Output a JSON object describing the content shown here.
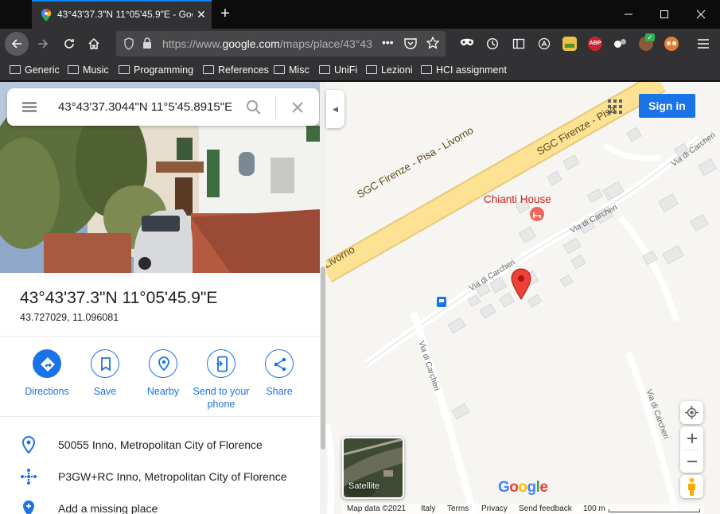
{
  "browser": {
    "tab_title": "43°43'37.3\"N 11°05'45.9\"E - Goo",
    "url_prefix": "https://www.",
    "url_domain": "google.com",
    "url_rest": "/maps/place/43°43",
    "bookmarks": [
      "Generic",
      "Music",
      "Programming",
      "References",
      "Misc",
      "UniFi",
      "Lezioni",
      "HCI assignment"
    ]
  },
  "search": {
    "query": "43°43'37.3044\"N 11°5'45.8915\"E"
  },
  "place": {
    "title": "43°43'37.3\"N 11°05'45.9\"E",
    "decimal": "43.727029, 11.096081"
  },
  "actions": [
    {
      "label": "Directions"
    },
    {
      "label": "Save"
    },
    {
      "label": "Nearby"
    },
    {
      "label": "Send to your phone"
    },
    {
      "label": "Share"
    }
  ],
  "info": [
    {
      "text": "50055 Inno, Metropolitan City of Florence",
      "icon": "location-pin-icon"
    },
    {
      "text": "P3GW+RC Inno, Metropolitan City of Florence",
      "icon": "plus-code-icon"
    },
    {
      "text": "Add a missing place",
      "icon": "add-place-icon"
    }
  ],
  "map": {
    "road_main": "SGC Firenze - Pisa - Livorno",
    "road_main_2": "SGC Firenze - Pisa - Livorno",
    "road_main_3": "Livorno",
    "road_main_4": "SGC Firenze - Pisa",
    "road_local": "Via di Carcheri",
    "poi": "Chianti House",
    "signin": "Sign in",
    "satellite": "Satellite",
    "google_logo": "Google",
    "footer": {
      "map_data": "Map data ©2021",
      "country": "Italy",
      "terms": "Terms",
      "privacy": "Privacy",
      "feedback": "Send feedback",
      "scale": "100 m"
    }
  },
  "colors": {
    "accent": "#1a73e8",
    "marker": "#d93025",
    "poi": "#c5221f",
    "highway": "#fde293"
  }
}
